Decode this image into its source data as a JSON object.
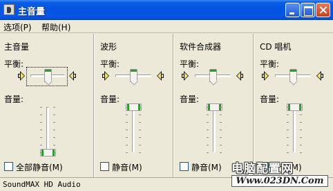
{
  "window": {
    "title": "主音量"
  },
  "menu": [
    {
      "label": "选项(P)"
    },
    {
      "label": "帮助(H)"
    }
  ],
  "columns": [
    {
      "heading": "主音量",
      "balance_label": "平衡:",
      "volume_label": "音量:",
      "checkbox_label": "全部静音(M)",
      "checkbox_checked": false,
      "balance_value": 0.5,
      "volume_value": 0.0
    },
    {
      "heading": "波形",
      "balance_label": "平衡:",
      "volume_label": "音量:",
      "checkbox_label": "静音(M)",
      "checkbox_checked": false,
      "balance_value": 0.5,
      "volume_value": 1.0
    },
    {
      "heading": "软件合成器",
      "balance_label": "平衡:",
      "volume_label": "音量:",
      "checkbox_label": "静音(M)",
      "checkbox_checked": false,
      "balance_value": 0.5,
      "volume_value": 1.0
    },
    {
      "heading": "CD 唱机",
      "balance_label": "平衡:",
      "volume_label": "音量:",
      "checkbox_label": "静音(M)",
      "checkbox_checked": false,
      "balance_value": 0.5,
      "volume_value": 1.0
    }
  ],
  "status": {
    "text": "SoundMAX HD Audio"
  },
  "watermark": {
    "line1": "电脑配置网",
    "line2": "Www.023DN.Com"
  },
  "colors": {
    "titlebar": "#0553e0",
    "thumb_accent": "#21a121",
    "window_bg": "#ece9d8"
  }
}
